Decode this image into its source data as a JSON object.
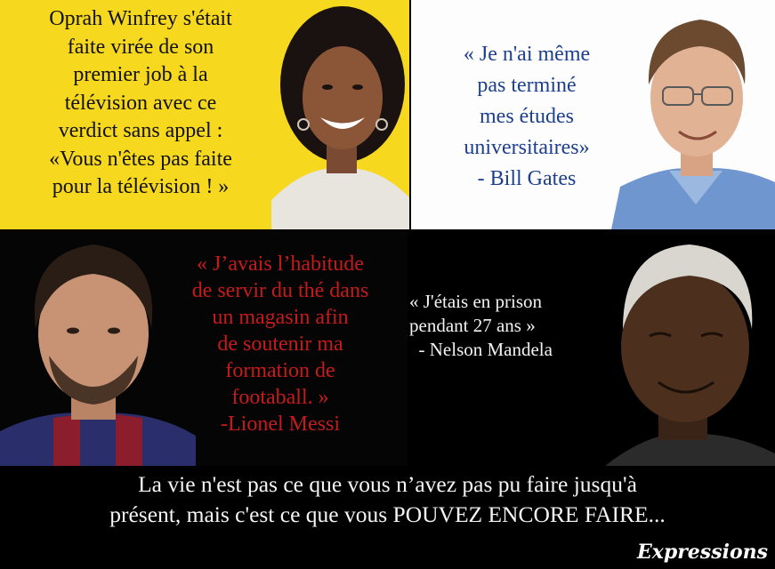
{
  "oprah": {
    "quote_lines": [
      "Oprah Winfrey s'était",
      "faite virée de son",
      "premier job à la",
      "télévision avec ce",
      "verdict sans appel :",
      "«Vous n'êtes pas faite",
      "pour la télévision ! »"
    ],
    "colors": {
      "background": "#f6d81e",
      "text": "#111111"
    }
  },
  "gates": {
    "quote_lines": [
      "« Je n'ai même",
      "pas terminé",
      "mes études",
      "universitaires»",
      "- Bill Gates"
    ],
    "colors": {
      "background": "#fdfdfd",
      "text": "#1c3f8e"
    }
  },
  "messi": {
    "quote_lines": [
      "« J’avais l’habitude",
      "de servir du thé dans",
      "un magasin afin",
      "de soutenir ma",
      "formation de",
      "footaball. »",
      "-Lionel Messi"
    ],
    "colors": {
      "background": "#050505",
      "text": "#c61b1b"
    }
  },
  "mandela": {
    "quote_lines": [
      "« J'étais en prison",
      "pendant 27 ans »",
      "  - Nelson Mandela"
    ],
    "colors": {
      "background": "#000000",
      "text": "#f2f2f2"
    }
  },
  "caption": {
    "line1": "La vie n'est pas ce que vous n’avez pas pu faire jusqu'à",
    "line2": "présent, mais c'est ce que vous POUVEZ ENCORE FAIRE..."
  },
  "signature": "Expressions"
}
